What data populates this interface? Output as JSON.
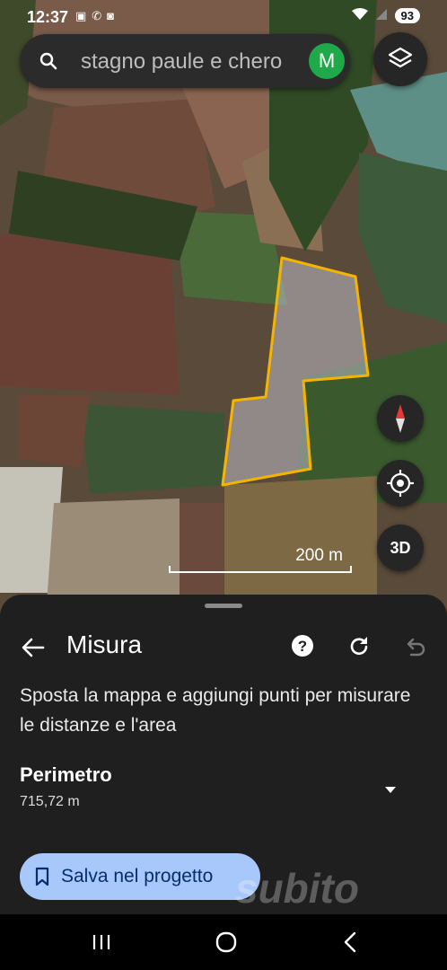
{
  "status": {
    "time": "12:37",
    "battery": "93"
  },
  "search": {
    "value": "stagno paule e chero",
    "avatar_letter": "M"
  },
  "map": {
    "scale_label": "200 m",
    "three_d_label": "3D"
  },
  "sheet": {
    "title": "Misura",
    "description": "Sposta la mappa e aggiungi punti per misurare le distanze e l'area",
    "perimeter_label": "Perimetro",
    "perimeter_value": "715,72 m",
    "save_label": "Salva nel progetto"
  },
  "watermark": "subito",
  "colors": {
    "polygon_outline": "#f4b400",
    "save_button": "#a8c7fa",
    "avatar": "#1fa94a"
  }
}
